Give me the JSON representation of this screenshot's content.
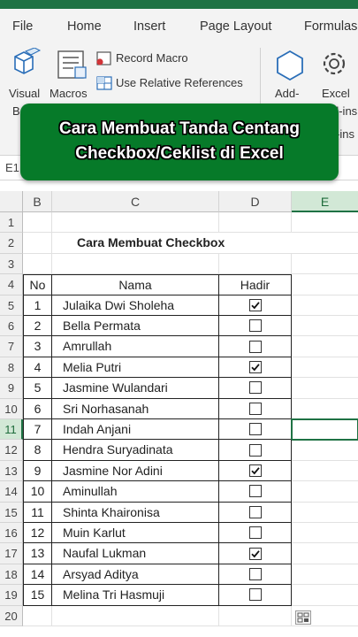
{
  "ribbon": {
    "tabs": [
      "File",
      "Home",
      "Insert",
      "Page Layout",
      "Formulas"
    ],
    "buttons": {
      "visual_basic": "Visual",
      "visual_basic_cut": "Ba",
      "macros": "Macros",
      "record_macro": "Record Macro",
      "relative_refs": "Use Relative References",
      "addins": "Add-",
      "excel": "Excel",
      "addins_cut": "d-ins",
      "addins_cut2": "-ins"
    }
  },
  "banner": {
    "line1": "Cara Membuat Tanda Centang",
    "line2": "Checkbox/Ceklist di Excel",
    "color": "#067a29"
  },
  "formula_bar": {
    "name_box": "E1"
  },
  "sheet": {
    "columns": [
      "B",
      "C",
      "D",
      "E"
    ],
    "selected_column": "E",
    "selected_row": "11",
    "title": "Cara Membuat Checkbox",
    "headers": {
      "no": "No",
      "nama": "Nama",
      "hadir": "Hadir"
    },
    "rows": [
      {
        "no": "1",
        "nama": "Julaika Dwi Sholeha",
        "checked": true
      },
      {
        "no": "2",
        "nama": "Bella Permata",
        "checked": false
      },
      {
        "no": "3",
        "nama": "Amrullah",
        "checked": false
      },
      {
        "no": "4",
        "nama": "Melia Putri",
        "checked": true
      },
      {
        "no": "5",
        "nama": "Jasmine Wulandari",
        "checked": false
      },
      {
        "no": "6",
        "nama": "Sri Norhasanah",
        "checked": false
      },
      {
        "no": "7",
        "nama": "Indah Anjani",
        "checked": false
      },
      {
        "no": "8",
        "nama": "Hendra Suryadinata",
        "checked": false
      },
      {
        "no": "9",
        "nama": "Jasmine Nor Adini",
        "checked": true
      },
      {
        "no": "10",
        "nama": "Aminullah",
        "checked": false
      },
      {
        "no": "11",
        "nama": "Shinta Khaironisa",
        "checked": false
      },
      {
        "no": "12",
        "nama": "Muin Karlut",
        "checked": false
      },
      {
        "no": "13",
        "nama": "Naufal Lukman",
        "checked": true
      },
      {
        "no": "14",
        "nama": "Arsyad Aditya",
        "checked": false
      },
      {
        "no": "15",
        "nama": "Melina Tri Hasmuji",
        "checked": false
      }
    ],
    "row_numbers": [
      "1",
      "2",
      "3",
      "4",
      "5",
      "6",
      "7",
      "8",
      "9",
      "10",
      "11",
      "12",
      "13",
      "14",
      "15",
      "16",
      "17",
      "18",
      "19",
      "20"
    ]
  },
  "colors": {
    "excel_green": "#1f7244",
    "banner_green": "#067a29"
  }
}
